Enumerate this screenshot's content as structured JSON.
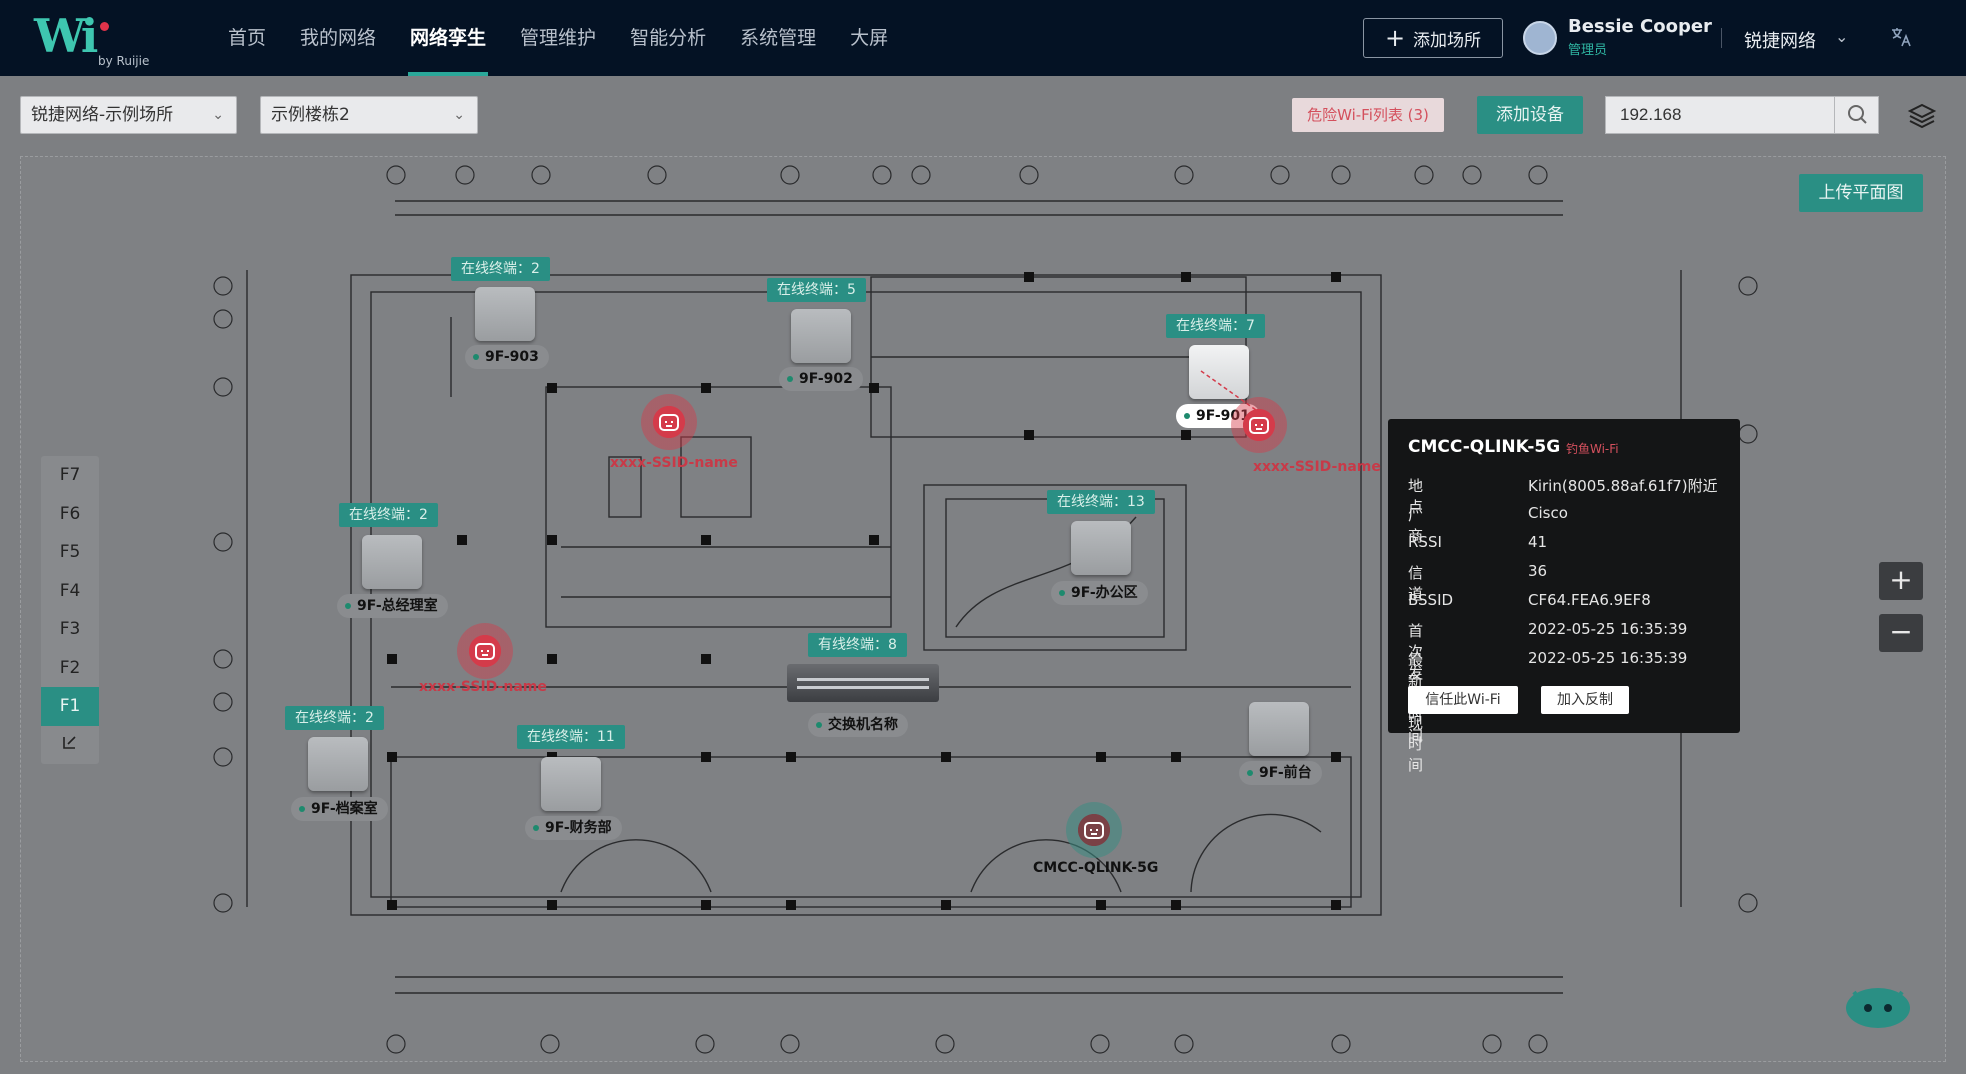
{
  "brand": {
    "logo": "Wi",
    "by": "by Ruijie"
  },
  "nav": [
    {
      "label": "首页"
    },
    {
      "label": "我的网络"
    },
    {
      "label": "网络孪生",
      "active": true
    },
    {
      "label": "管理维护"
    },
    {
      "label": "智能分析"
    },
    {
      "label": "系统管理"
    },
    {
      "label": "大屏"
    }
  ],
  "header": {
    "add_site": "添加场所",
    "user_name": "Bessie Cooper",
    "user_role": "管理员",
    "org": "锐捷网络"
  },
  "toolbar": {
    "site": "锐捷网络-示例场所",
    "building": "示例楼栋2",
    "danger_wifi": "危险Wi-Fi列表 (3)",
    "add_device": "添加设备",
    "search_value": "192.168"
  },
  "map": {
    "upload": "上传平面图",
    "floors": [
      "F7",
      "F6",
      "F5",
      "F4",
      "F3",
      "F2",
      "F1"
    ],
    "active_floor": "F1",
    "aps": [
      {
        "name": "9F-903",
        "online": "在线终端：2"
      },
      {
        "name": "9F-902",
        "online": "在线终端：5"
      },
      {
        "name": "9F-901",
        "online": "在线终端：7"
      },
      {
        "name": "9F-总经理室",
        "online": "在线终端：2"
      },
      {
        "name": "9F-办公区",
        "online": "在线终端：13"
      },
      {
        "name": "9F-档案室",
        "online": "在线终端：2"
      },
      {
        "name": "9F-财务部",
        "online": "在线终端：11"
      },
      {
        "name": "9F-前台",
        "online": ""
      }
    ],
    "switch": {
      "name": "交换机名称",
      "wired": "有线终端：8"
    },
    "rogues": [
      {
        "name": "xxxx-SSID-name"
      },
      {
        "name": "xxxx-SSID-name"
      },
      {
        "name": "xxxx-SSID-name"
      },
      {
        "name": "CMCC-QLINK-5G"
      }
    ]
  },
  "popup": {
    "title": "CMCC-QLINK-5G",
    "tag": "钓鱼Wi-Fi",
    "rows": [
      {
        "k": "地点",
        "v": "Kirin(8005.88af.61f7)附近"
      },
      {
        "k": "厂商",
        "v": "Cisco"
      },
      {
        "k": "RSSI",
        "v": "41"
      },
      {
        "k": "信道",
        "v": "36"
      },
      {
        "k": "BSSID",
        "v": "CF64.FEA6.9EF8"
      },
      {
        "k": "首次发现时间",
        "v": "2022-05-25 16:35:39"
      },
      {
        "k": "最新发现时间",
        "v": "2022-05-25 16:35:39"
      }
    ],
    "trust": "信任此Wi-Fi",
    "counter": "加入反制"
  },
  "colors": {
    "accent": "#2a8f84",
    "danger": "#d4505d",
    "topbar": "#041224"
  }
}
